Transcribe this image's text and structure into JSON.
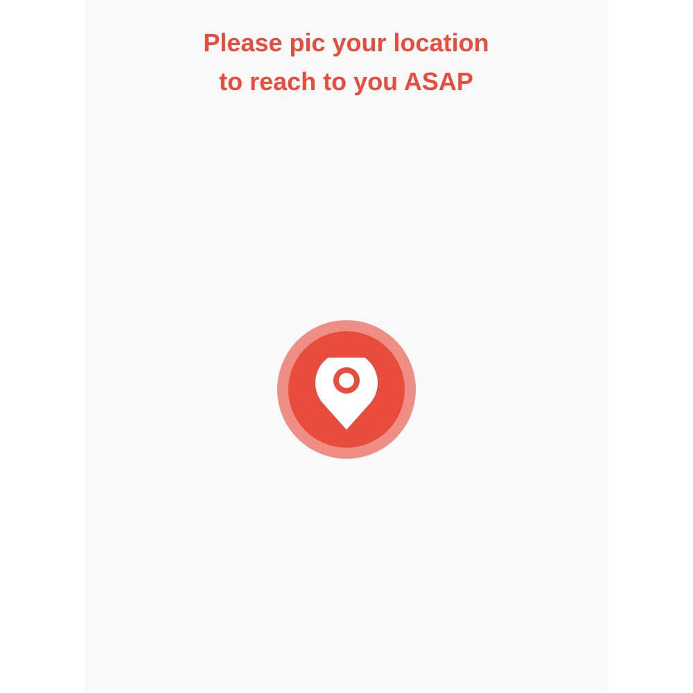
{
  "prompt": {
    "line1": "Please pic your location",
    "line2": "to reach to you ASAP"
  },
  "location_button": {
    "icon": "map-pin-icon"
  },
  "colors": {
    "accent": "#e74c3c",
    "background": "#f9f9f9",
    "icon": "#ffffff"
  }
}
